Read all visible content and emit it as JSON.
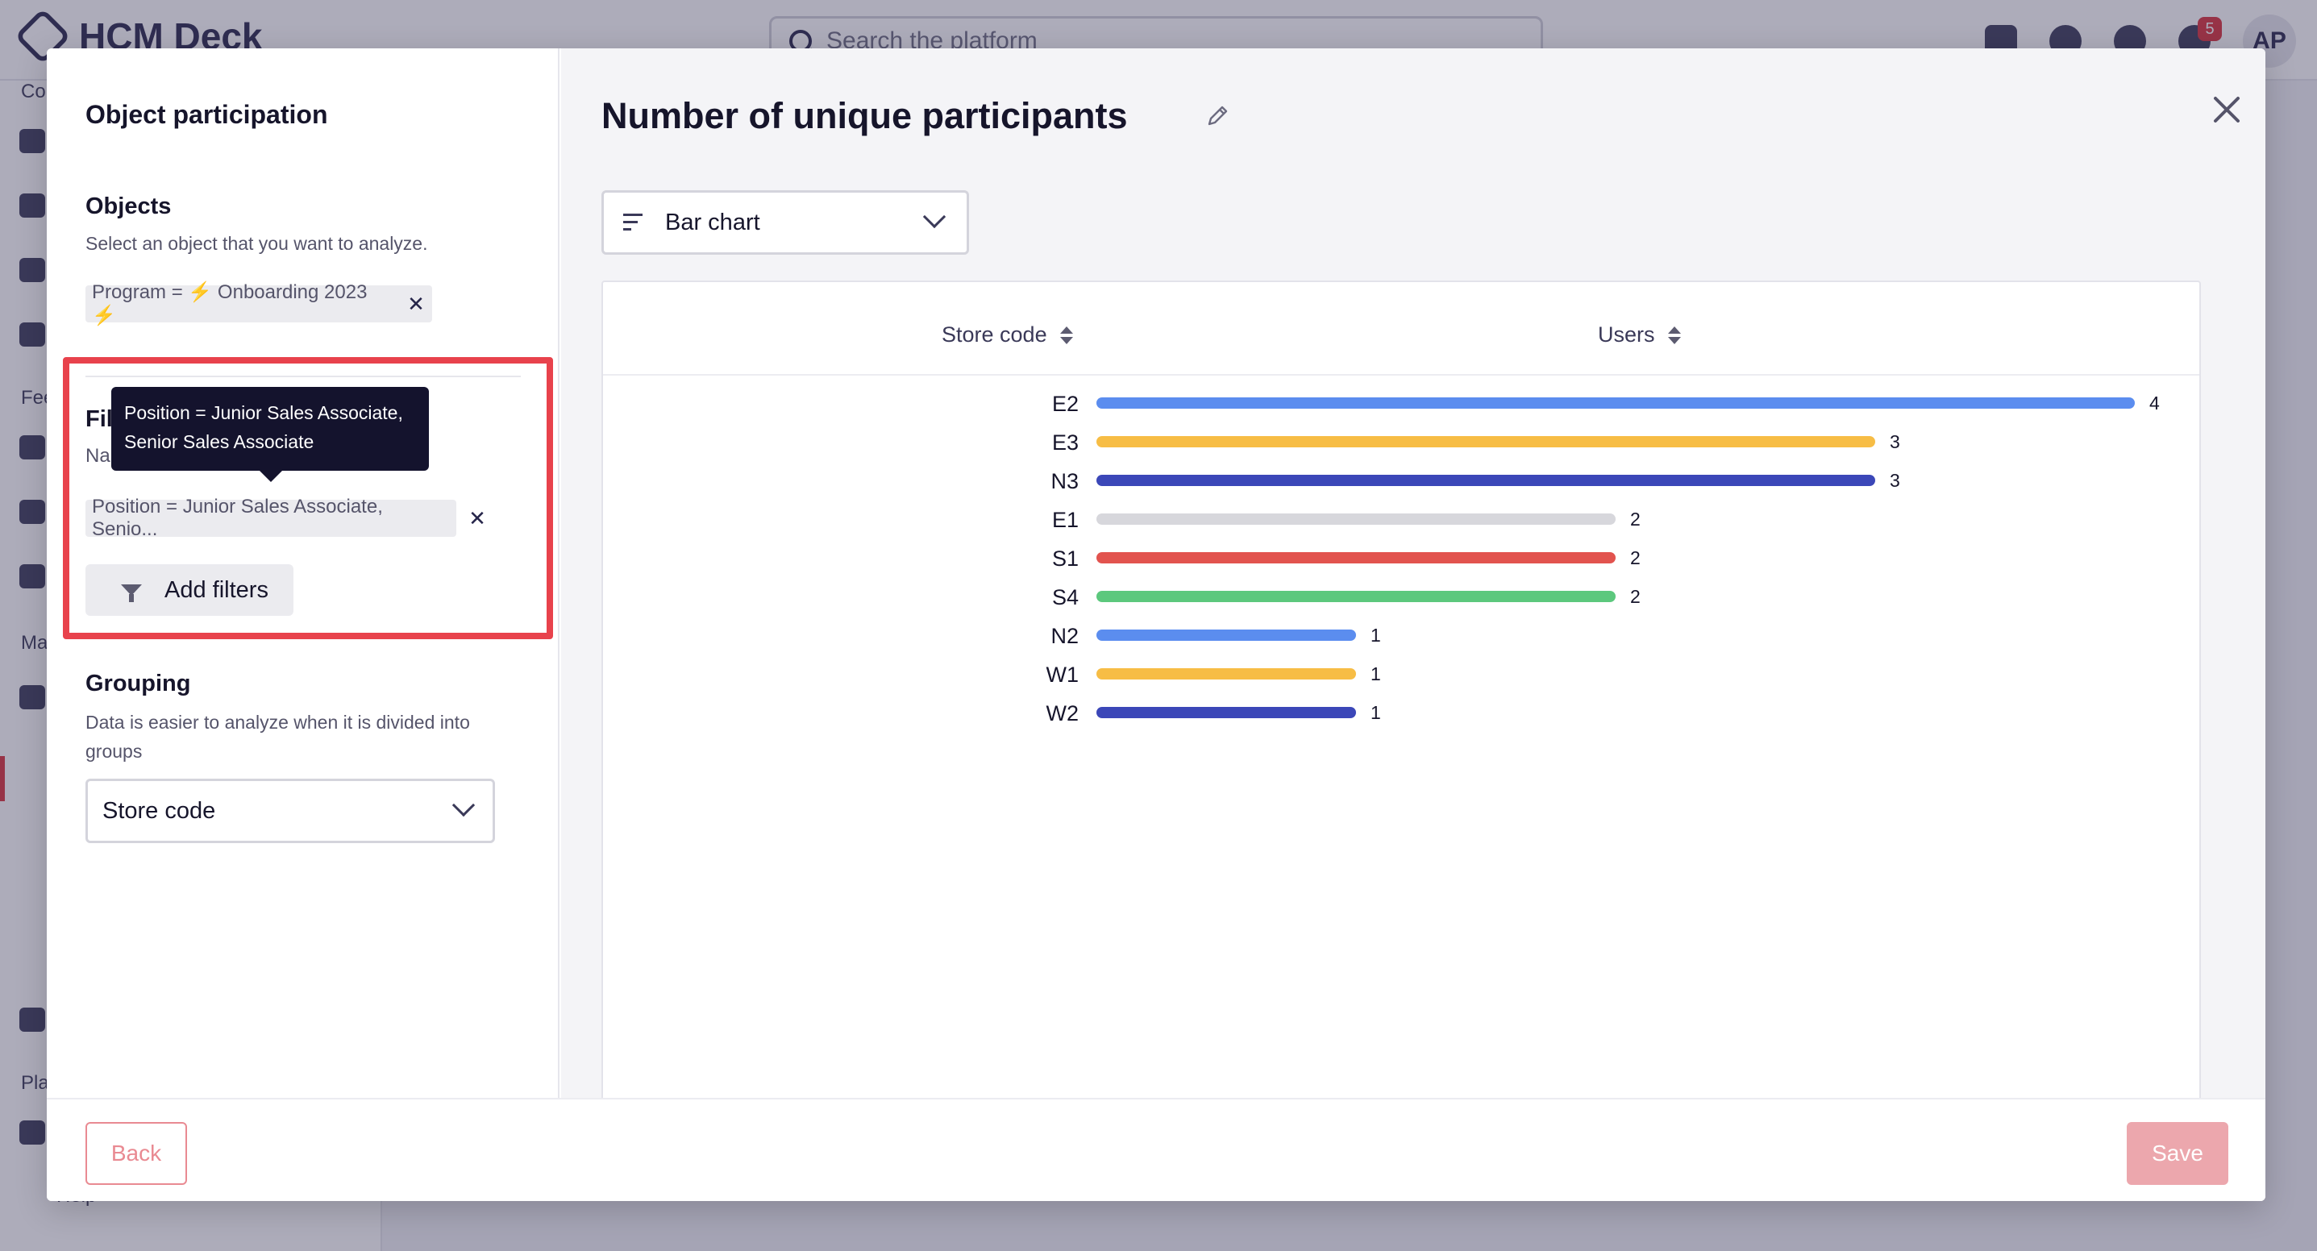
{
  "background": {
    "app_name": "HCM Deck",
    "search_placeholder": "Search the platform",
    "notification_count": "5",
    "avatar_initials": "AP",
    "sidebar_fragments": [
      "Co",
      "Fee",
      "Ma",
      "Pla",
      "Help"
    ]
  },
  "left_panel": {
    "title": "Object participation",
    "objects": {
      "title": "Objects",
      "description": "Select an object that you want to analyze.",
      "chip": "Program = ⚡ Onboarding 2023 ⚡"
    },
    "filters": {
      "title_partial": "Fil",
      "desc_partial": "Na",
      "chip": "Position = Junior Sales Associate, Senio...",
      "tooltip_line1": "Position = Junior Sales Associate,",
      "tooltip_line2": "Senior Sales Associate",
      "add_button": "Add filters"
    },
    "grouping": {
      "title": "Grouping",
      "description": "Data is easier to analyze when it is divided into groups",
      "selected": "Store code"
    }
  },
  "right_panel": {
    "title": "Number of unique participants",
    "chart_type_selected": "Bar chart",
    "table_headers": {
      "store_code": "Store code",
      "users": "Users"
    }
  },
  "footer": {
    "back_label": "Back",
    "save_label": "Save"
  },
  "chart_data": {
    "type": "bar",
    "orientation": "horizontal",
    "categories": [
      "E2",
      "E3",
      "N3",
      "E1",
      "S1",
      "S4",
      "N2",
      "W1",
      "W2"
    ],
    "values": [
      4,
      3,
      3,
      2,
      2,
      2,
      1,
      1,
      1
    ],
    "colors": [
      "#5b8def",
      "#f7bd45",
      "#3b47b8",
      "#d7d7dc",
      "#e2534e",
      "#5cc87d",
      "#5b8def",
      "#f7bd45",
      "#3b47b8"
    ],
    "xlim": [
      0,
      4
    ],
    "grid": false,
    "title": "",
    "xlabel": "Users",
    "ylabel": "Store code"
  }
}
